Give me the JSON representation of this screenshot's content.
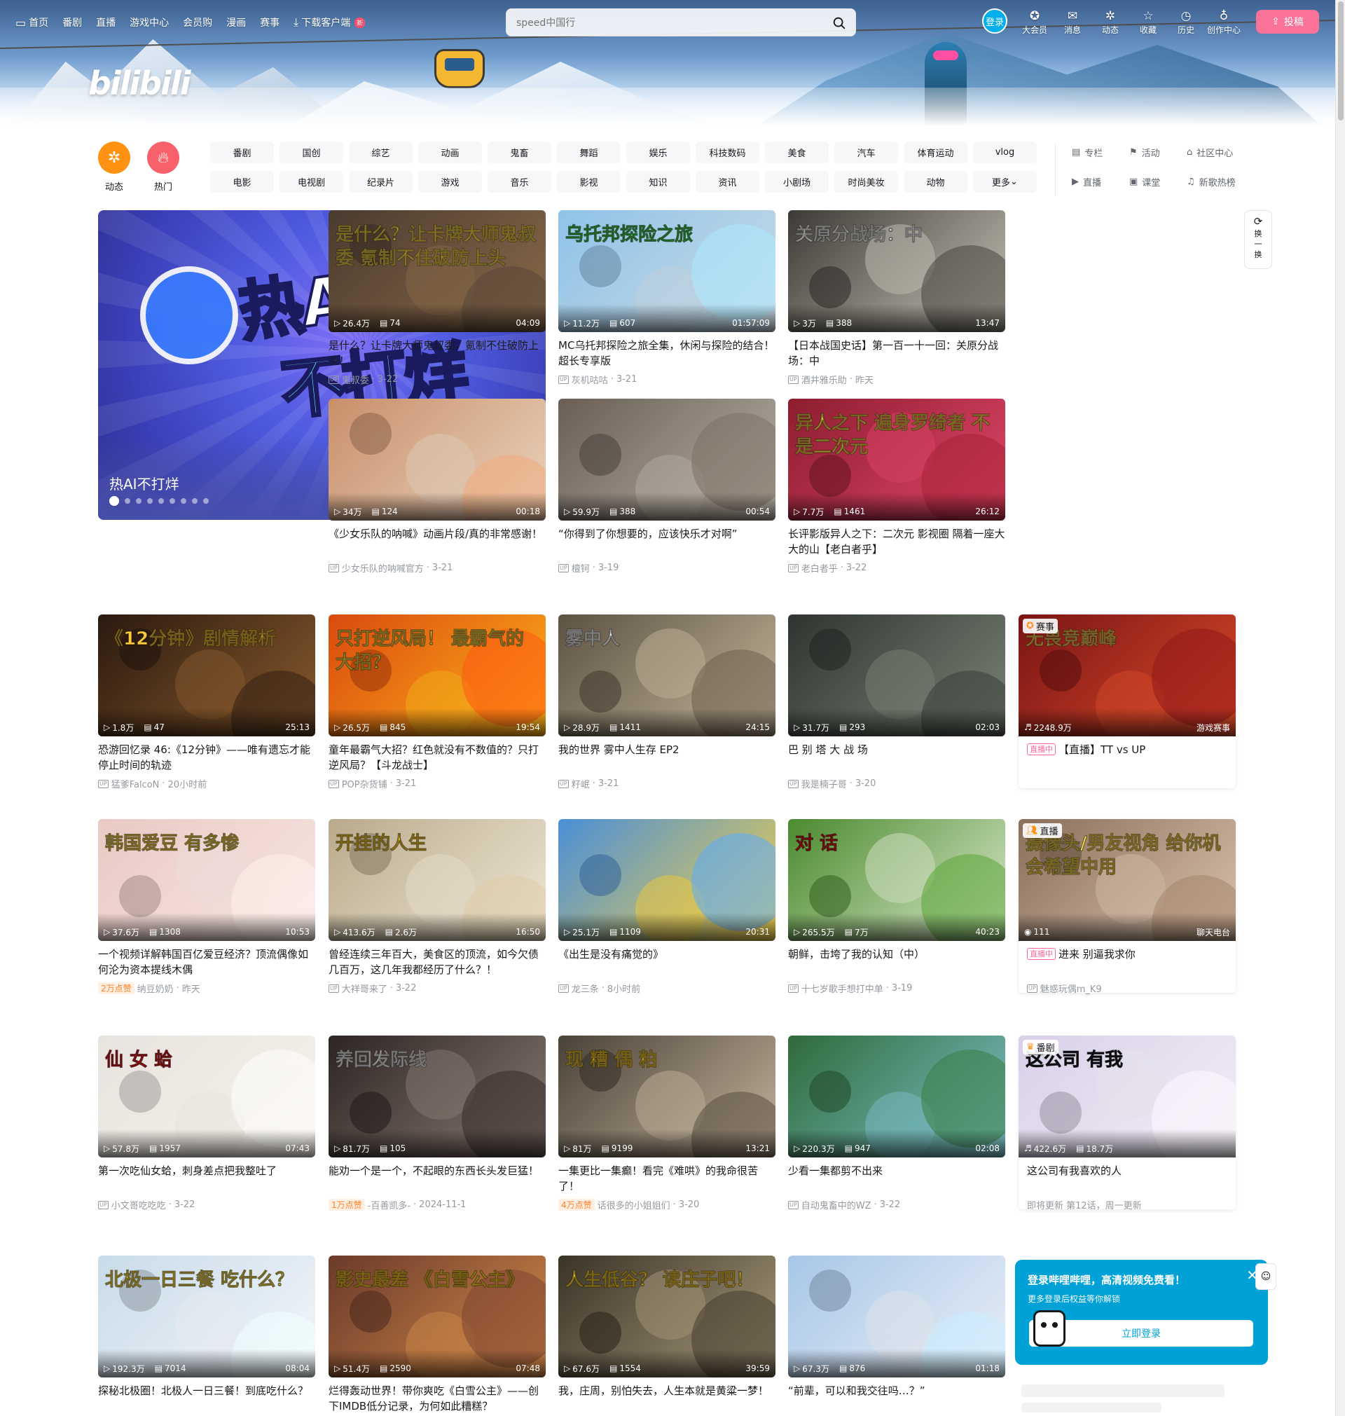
{
  "topnav": {
    "items": [
      {
        "label": "首页",
        "icon": "tv-icon"
      },
      {
        "label": "番剧"
      },
      {
        "label": "直播"
      },
      {
        "label": "游戏中心"
      },
      {
        "label": "会员购"
      },
      {
        "label": "漫画"
      },
      {
        "label": "赛事"
      },
      {
        "label": "下载客户端",
        "icon": "download-icon",
        "badge": "新"
      }
    ]
  },
  "search": {
    "placeholder": "speed中国行"
  },
  "user": {
    "login_label": "登录",
    "items": [
      {
        "label": "大会员",
        "icon": "vip-icon"
      },
      {
        "label": "消息",
        "icon": "mail-icon"
      },
      {
        "label": "动态",
        "icon": "wind-icon"
      },
      {
        "label": "收藏",
        "icon": "star-icon"
      },
      {
        "label": "历史",
        "icon": "clock-icon"
      },
      {
        "label": "创作中心",
        "icon": "bulb-icon"
      }
    ],
    "upload_label": "投稿"
  },
  "logo_text": "bilibili",
  "quick": [
    {
      "label": "动态",
      "color": "#ff9212"
    },
    {
      "label": "热门",
      "color": "#f9616a"
    }
  ],
  "channels": [
    "番剧",
    "国创",
    "综艺",
    "动画",
    "鬼畜",
    "舞蹈",
    "娱乐",
    "科技数码",
    "美食",
    "汽车",
    "体育运动",
    "vlog",
    "电影",
    "电视剧",
    "纪录片",
    "游戏",
    "音乐",
    "影视",
    "知识",
    "资讯",
    "小剧场",
    "时尚美妆",
    "动物",
    "更多"
  ],
  "channel_extras": [
    {
      "label": "专栏",
      "icon": "article-icon"
    },
    {
      "label": "活动",
      "icon": "flag-icon"
    },
    {
      "label": "社区中心",
      "icon": "community-icon"
    },
    {
      "label": "直播",
      "icon": "live-icon"
    },
    {
      "label": "课堂",
      "icon": "classroom-icon"
    },
    {
      "label": "新歌热榜",
      "icon": "music-chart-icon"
    }
  ],
  "carousel": {
    "title": "热AI不打烊",
    "art_line1": "热AI",
    "art_line2": "不打烊",
    "dot_count": 9,
    "active_dot": 0
  },
  "refresh": {
    "label": "换一换"
  },
  "cards": [
    {
      "title": "是什么？让卡牌大师鬼叔委，氪制不住破防上头！",
      "views": "26.4万",
      "danmaku": "74",
      "duration": "04:09",
      "author": "鬼叔委",
      "date": "3-22",
      "thumb_text": "是什么？让卡牌大师鬼叔委 氪制不住破防上头",
      "colors": [
        "#4a3b2f",
        "#8a6a4a"
      ],
      "text_color": "#ffe14a"
    },
    {
      "title": "MC乌托邦探险之旅全集，休闲与探险的结合！超长专享版",
      "views": "11.2万",
      "danmaku": "607",
      "duration": "01:57:09",
      "author": "灰机咕咕",
      "date": "3-21",
      "thumb_text": "乌托邦探险之旅",
      "colors": [
        "#8fc3e8",
        "#c9dbe6"
      ],
      "text_color": "#44d34f"
    },
    {
      "title": "【日本战国史话】第一百一十一回：关原分战场：中",
      "views": "3万",
      "danmaku": "388",
      "duration": "13:47",
      "author": "酒井雅乐助",
      "date": "昨天",
      "thumb_text": "关原分战场：中",
      "colors": [
        "#3d3a36",
        "#c9c4b8"
      ],
      "text_color": "#ffffff"
    },
    {
      "title": "《少女乐队的呐喊》动画片段/真的非常感谢！",
      "views": "34万",
      "danmaku": "124",
      "duration": "00:18",
      "author": "少女乐队的呐喊官方",
      "date": "3-21",
      "thumb_text": "",
      "colors": [
        "#c98f6a",
        "#e9d3bd"
      ],
      "text_color": "#ffffff"
    },
    {
      "title": "“你得到了你想要的，应该快乐才对啊”",
      "views": "59.9万",
      "danmaku": "388",
      "duration": "00:54",
      "author": "檀钶",
      "date": "3-19",
      "thumb_text": "",
      "colors": [
        "#6a5e55",
        "#b9b2a6"
      ],
      "text_color": "#ffffff"
    },
    {
      "title": "长评影版异人之下：二次元 影视圈 隔着一座大大的山【老白者乎】",
      "views": "7.7万",
      "danmaku": "1461",
      "duration": "26:12",
      "author": "老白者乎",
      "date": "3-22",
      "thumb_text": "异人之下 遍身罗绮者 不是二次元",
      "colors": [
        "#8c1d2f",
        "#e2466a"
      ],
      "text_color": "#ffe14a"
    },
    {
      "title": "恐游回忆录 46:《12分钟》——唯有遗忘才能停止时间的轨迹",
      "views": "1.8万",
      "danmaku": "47",
      "duration": "25:13",
      "author": "猛爹FalcoN",
      "date": "20小时前",
      "thumb_text": "《12分钟》剧情解析",
      "colors": [
        "#2a1a10",
        "#8a5a2c"
      ],
      "text_color": "#ffc93a"
    },
    {
      "title": "童年最霸气大招？红色就没有不数值的？只打逆风局？【斗龙战士】",
      "views": "26.5万",
      "danmaku": "845",
      "duration": "19:54",
      "author": "POP杂货铺",
      "date": "3-21",
      "thumb_text": "只打逆风局！ 最霸气的大招？",
      "colors": [
        "#d94a0e",
        "#ffb21a"
      ],
      "text_color": "#ffe14a"
    },
    {
      "title": "我的世界 雾中人生存 EP2",
      "views": "28.9万",
      "danmaku": "1411",
      "duration": "24:15",
      "author": "籽岷",
      "date": "3-21",
      "thumb_text": "雾中人",
      "colors": [
        "#5c5242",
        "#c4b79c"
      ],
      "text_color": "#ffffff"
    },
    {
      "title": "巴 别 塔 大 战 场",
      "views": "31.7万",
      "danmaku": "293",
      "duration": "02:03",
      "author": "我是楠子哥",
      "date": "3-20",
      "thumb_text": "",
      "colors": [
        "#2f3430",
        "#7b8477"
      ],
      "text_color": "#ffffff"
    },
    {
      "title": "【直播】TT vs UP",
      "views": "2248.9万",
      "danmaku": "",
      "duration": "游戏赛事",
      "author": "",
      "date": "",
      "thumb_text": "无畏竞巅峰",
      "colors": [
        "#7a1414",
        "#d94a2a"
      ],
      "text_color": "#ffd65a",
      "corner": "赛事",
      "live_tag": "直播中",
      "boxed": true
    },
    {
      "title": "一个视频详解韩国百亿爱豆经济？顶流偶像如何沦为资本提线木偶",
      "views": "37.6万",
      "danmaku": "1308",
      "duration": "10:53",
      "author": "纳豆奶奶",
      "date": "昨天",
      "likes": "2万点赞",
      "thumb_text": "韩国爱豆 有多惨",
      "colors": [
        "#e9c9c4",
        "#f7e7e2"
      ],
      "text_color": "#ffe14a"
    },
    {
      "title": "曾经连续三年百大，美食区的顶流，如今欠债几百万，这几年我都经历了什么？！",
      "views": "413.6万",
      "danmaku": "2.6万",
      "duration": "16:50",
      "author": "大祥哥来了",
      "date": "3-22",
      "thumb_text": "开挂的人生",
      "colors": [
        "#b9aa8c",
        "#efe7d4"
      ],
      "text_color": "#ffd12a"
    },
    {
      "title": "《出生是没有痛觉的》",
      "views": "25.1万",
      "danmaku": "1109",
      "duration": "20:31",
      "author": "龙三条",
      "date": "8小时前",
      "thumb_text": "",
      "colors": [
        "#4a8fd8",
        "#f2d04a"
      ],
      "text_color": "#ffffff"
    },
    {
      "title": "朝鲜，击垮了我的认知（中）",
      "views": "265.5万",
      "danmaku": "7万",
      "duration": "40:23",
      "author": "十七岁歌手想打中单",
      "date": "3-19",
      "thumb_text": "对 话",
      "colors": [
        "#4b8a2f",
        "#d9e8c9"
      ],
      "text_color": "#e31b23"
    },
    {
      "title": "进来 别逼我求你",
      "views": "111",
      "danmaku": "",
      "duration": "聊天电台",
      "author": "魅惑玩偶m_K9",
      "date": "",
      "thumb_text": "摄像头/男友视角 给你机会希望中用",
      "colors": [
        "#8a6f5a",
        "#d9c3ad"
      ],
      "text_color": "#ffe14a",
      "corner": "直播",
      "live_tag": "直播中",
      "boxed": true
    },
    {
      "title": "第一次吃仙女蛤，刺身差点把我整吐了",
      "views": "57.8万",
      "danmaku": "1957",
      "duration": "07:43",
      "author": "小文哥吃吃吃",
      "date": "3-22",
      "thumb_text": "仙 女 蛤",
      "colors": [
        "#e8e3de",
        "#f6f1ea"
      ],
      "text_color": "#e31b23"
    },
    {
      "title": "能劝一个是一个，不起眼的东西长头发巨猛！",
      "views": "81.7万",
      "danmaku": "105",
      "duration": "",
      "author": "-百善凯多-",
      "date": "2024-11-1",
      "likes": "1万点赞",
      "thumb_text": "养回发际线",
      "colors": [
        "#2c2523",
        "#8b7b74"
      ],
      "text_color": "#ffffff"
    },
    {
      "title": "一集更比一集癫！看完《难哄》的我命很苦了！",
      "views": "81万",
      "danmaku": "9199",
      "duration": "13:21",
      "author": "话很多的小姐姐们",
      "date": "3-20",
      "likes": "4万点赞",
      "thumb_text": "现 糟 偶 粕",
      "colors": [
        "#4a4238",
        "#c5b49c"
      ],
      "text_color": "#ffd12a"
    },
    {
      "title": "少看一集都剪不出来",
      "views": "220.3万",
      "danmaku": "947",
      "duration": "02:08",
      "author": "自动鬼畜中的WZ",
      "date": "3-22",
      "thumb_text": "",
      "colors": [
        "#2f6a3a",
        "#7cc2c8"
      ],
      "text_color": "#ffffff"
    },
    {
      "title": "这公司有我喜欢的人",
      "views": "422.6万",
      "danmaku": "18.7万",
      "duration": "",
      "author": "",
      "date": "",
      "extra_meta": "即将更新 第12话，周一更新",
      "thumb_text": "这公司 有我",
      "colors": [
        "#d9d0e8",
        "#f2eef7"
      ],
      "text_color": "#18191c",
      "corner": "番剧",
      "boxed": true
    },
    {
      "title": "探秘北极圈！北极人一日三餐！到底吃什么？",
      "views": "192.3万",
      "danmaku": "7014",
      "duration": "08:04",
      "author": "",
      "date": "",
      "thumb_text": "北极一日三餐 吃什么？",
      "colors": [
        "#c9dbe9",
        "#f2f6fa"
      ],
      "text_color": "#ffe14a"
    },
    {
      "title": "烂得轰动世界！带你爽吃《白雪公主》——创下IMDB低分记录，为何如此糟糕？",
      "views": "51.4万",
      "danmaku": "2590",
      "duration": "07:48",
      "author": "",
      "date": "",
      "thumb_text": "影史最差 《白雪公主》",
      "colors": [
        "#6a3a2a",
        "#d48a4a"
      ],
      "text_color": "#ffd12a"
    },
    {
      "title": "我，庄周，别怕失去，人生本就是黄粱一梦！",
      "views": "67.6万",
      "danmaku": "1554",
      "duration": "39:59",
      "author": "",
      "date": "",
      "thumb_text": "人生低谷？ 读庄子吧！",
      "colors": [
        "#3a3326",
        "#a89a7c"
      ],
      "text_color": "#ffd12a"
    },
    {
      "title": "“前辈，可以和我交往吗…？”",
      "views": "67.3万",
      "danmaku": "876",
      "duration": "01:18",
      "author": "",
      "date": "",
      "thumb_text": "",
      "colors": [
        "#a8c7e8",
        "#e9eef5"
      ],
      "text_color": "#ffffff"
    }
  ],
  "login_popup": {
    "title": "登录哔哩哔哩，高清视频免费看！",
    "subtitle": "更多登录后权益等你解锁",
    "button": "立即登录"
  }
}
